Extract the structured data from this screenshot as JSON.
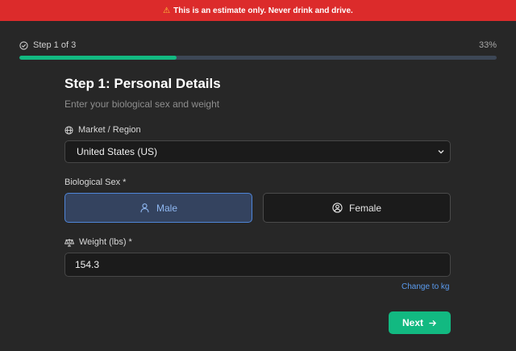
{
  "banner": {
    "icon": "warning-icon",
    "text": "This is an estimate only. Never drink and drive."
  },
  "progress": {
    "step_text": "Step 1 of 3",
    "percent_text": "33%",
    "fraction": 0.33
  },
  "form": {
    "title": "Step 1: Personal Details",
    "subtitle": "Enter your biological sex and weight",
    "region_label": "Market / Region",
    "region_value": "United States (US)",
    "sex_label": "Biological Sex *",
    "sex_options": [
      "Male",
      "Female"
    ],
    "selected_sex": "Male",
    "weight_label": "Weight (lbs) *",
    "weight_value": "154.3",
    "change_unit_link": "Change to kg",
    "next_label": "Next"
  },
  "colors": {
    "accent": "#12b981",
    "danger": "#dc2b2b",
    "selected": "#4f86d9",
    "link": "#5b9cf0"
  }
}
